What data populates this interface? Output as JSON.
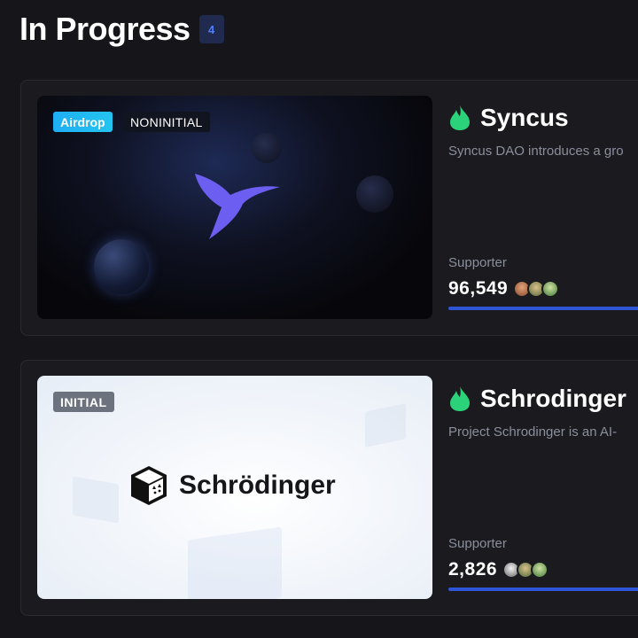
{
  "section": {
    "title": "In Progress",
    "count": "4"
  },
  "projects": [
    {
      "name": "Syncus",
      "description": "Syncus DAO introduces a gro",
      "tags": [
        "Airdrop",
        "NONINITIAL"
      ],
      "supporter_label": "Supporter",
      "supporter_count": "96,549",
      "icon": "flame-icon",
      "logo": "hummingbird-logo"
    },
    {
      "name": "Schrodinger",
      "description": "Project Schrodinger is an AI-",
      "tags": [
        "INITIAL"
      ],
      "supporter_label": "Supporter",
      "supporter_count": "2,826",
      "logo_text": "Schrödinger",
      "icon": "flame-icon",
      "logo": "cat-box-logo"
    }
  ],
  "colors": {
    "background": "#15151a",
    "card": "#1a1a1f",
    "accent_blue": "#2d55d6",
    "flame_green": "#2bd27a",
    "airdrop_tag": "#1eaef5",
    "initial_tag": "#6c737f"
  }
}
